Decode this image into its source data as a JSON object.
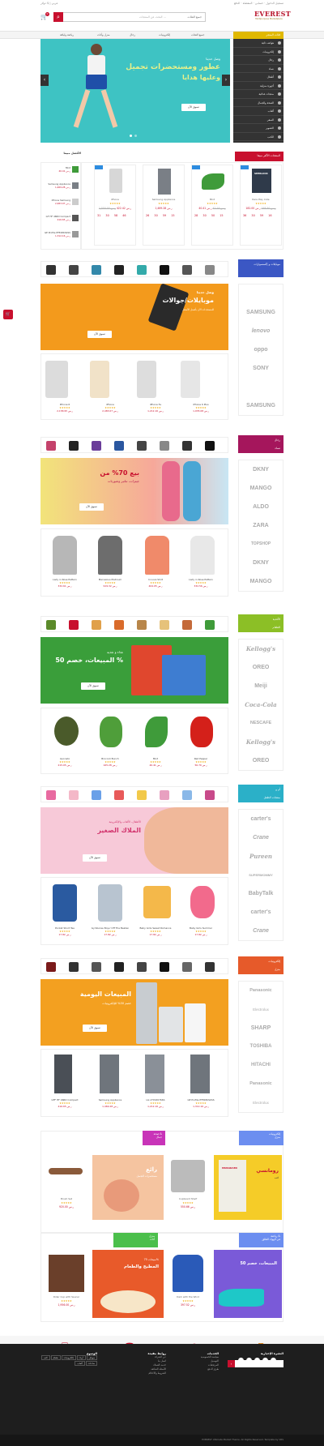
{
  "topbar": {
    "left": "عربي  |  $ دولار",
    "links": [
      "تسجيل الدخول",
      "حسابي",
      "المفضلة",
      "الدفع"
    ]
  },
  "header": {
    "logo": "EVEREST",
    "tagline": "Multipurpose Marketplace",
    "search_placeholder": "البحث عن المنتجات ...",
    "category_select": "جميع الفئات",
    "cart_count": "0"
  },
  "nav": {
    "categories_label": "فئات المتجر",
    "items": [
      "جميع الفئات",
      "إلكترونيات",
      "رجال",
      "منزل وأثاث",
      "رياضة ولياقة"
    ]
  },
  "sidebar": {
    "items": [
      "هواتف ذكية",
      "إلكترونيات",
      "رجال",
      "نساء",
      "أطفال",
      "أجهزة منزلية",
      "منتجات غذائية",
      "الصحة والجمال",
      "ألعاب",
      "السفر",
      "التصوير",
      "الكتب",
      "المزيد"
    ]
  },
  "slider": {
    "line1": "وصل حديثا",
    "line2": "عطور ومستحضرات تجميل",
    "line3": "وعليها هدايا",
    "button": "تسوق الآن"
  },
  "best_sellers": {
    "title": "المنتجات الأكثر مبيعا",
    "side_title": "الأفضل مبيعا",
    "products": [
      {
        "name": "Rare Play Cote",
        "old": "ر.س 193.50",
        "price": "ر.س 182.00",
        "timer": [
          "36",
          "30",
          "59",
          "16"
        ]
      },
      {
        "name": "Mint",
        "old": "ر.س 42.14",
        "price": "ر.س 40.41",
        "timer": [
          "28",
          "30",
          "50",
          "15"
        ]
      },
      {
        "name": "Samsung Appliance",
        "old": "",
        "price": "ر.س 1,469.28",
        "timer": [
          "26",
          "30",
          "59",
          "15"
        ]
      },
      {
        "name": "iPhone",
        "old": "ر.س 1,550.00",
        "price": "ر.س 422.42",
        "timer": [
          "31",
          "30",
          "58",
          "46"
        ]
      }
    ],
    "side": [
      {
        "name": "Mint",
        "price": "ر.س 40.41"
      },
      {
        "name": "Samsung Appliance",
        "price": "ر.س 1,469.28"
      },
      {
        "name": "iPhone Samsung",
        "price": "ر.س 2,483.07"
      },
      {
        "name": "GF HF 46RD Compact",
        "price": "ر.س 416.65"
      },
      {
        "name": "GE Profile PFE28KSKSS",
        "price": "ر.س 1,312.16"
      }
    ]
  },
  "phones": {
    "title": "موبايلات و إكسسوارات",
    "banner_l1": "وصل حديثا",
    "banner_l2": "موبايلات/جوالات",
    "banner_l3": "للمستجدات الآن بأفضل الأسعار",
    "button": "تسوق الآن",
    "brands": [
      "SAMSUNG",
      "lenovo",
      "oppo",
      "SONY",
      "SAMSUNG"
    ],
    "products": [
      {
        "name": "iPhone 6 Plus",
        "price": "ر.س 1,935.08"
      },
      {
        "name": "iPhone 5s",
        "price": "ر.س 1,212.16"
      },
      {
        "name": "iPhone",
        "price": "ر.س 2,483.07"
      },
      {
        "name": "iPhone 6",
        "price": "ر.س 2,158.95"
      }
    ]
  },
  "fashion": {
    "title": "رجال",
    "sub": "نساء",
    "banner_l1": "بيع 70% من",
    "banner_l2": "جينزات، تنانير وشورتات",
    "button": "تسوق الآن",
    "brands": [
      "DKNY",
      "MANGO",
      "ALDO",
      "ZARA",
      "TOPSHOP",
      "DKNY",
      "MANGO"
    ],
    "products": [
      {
        "name": "Lady in Rose Pattern",
        "price": "ر.س 332.56"
      },
      {
        "name": "In Love Shirt",
        "price": "ر.س 404.05"
      },
      {
        "name": "Marvelous Platinum",
        "price": "ر.س 919.32"
      },
      {
        "name": "Lady in Rose Pattern",
        "price": "ر.س 332.61"
      }
    ]
  },
  "food": {
    "title": "الأغذية",
    "sub": "الطعام",
    "banner_l1": "غذاء و تغذية",
    "banner_l2": "المبيعات، خصم 50 %",
    "button": "تسوق الآن",
    "brands": [
      "Kellogg's",
      "OREO",
      "Meiji",
      "Coca-Cola",
      "NESCAFE",
      "Kellogg's",
      "OREO"
    ],
    "products": [
      {
        "name": "Avocado",
        "price": "ر.س 215.05"
      },
      {
        "name": "Broccoli Bunch",
        "price": "ر.س 165.28"
      },
      {
        "name": "Mint",
        "price": "ر.س 40.41"
      },
      {
        "name": "Red Pepper",
        "price": "ر.س 56.70"
      }
    ]
  },
  "kids": {
    "title": "أم و",
    "sub": "منتجات الطفل",
    "banner_l1": "الأطفال، الألعاب والإلكترونية",
    "banner_l2": "الملاك الصغير",
    "button": "تسوق الآن",
    "brands": [
      "carter's",
      "Crane",
      "Pureen",
      "SUPERMOMMY",
      "BabyTalk",
      "carter's",
      "Crane"
    ],
    "products": [
      {
        "name": "Baby Girls Summer",
        "price": "ر.س 17.82"
      },
      {
        "name": "Baby Girls Sweet Romance",
        "price": "ر.س 17.82"
      },
      {
        "name": "Gymboree Boys' Off The Beaten",
        "price": "ر.س 17.82"
      },
      {
        "name": "Pocket Short Tee",
        "price": "ر.س 17.82"
      }
    ]
  },
  "electronics": {
    "title": "إلكترونيات",
    "sub": "منزل",
    "banner_l1": "المبيعات اليومية",
    "banner_l2": "خصم 30% للإلكترونيات",
    "button": "تسوق الآن",
    "brands": [
      "Panasonic",
      "Electrolux",
      "SHARP",
      "TOSHIBA",
      "HITACHI",
      "Panasonic",
      "Electrolux"
    ],
    "products": [
      {
        "name": "GE Profile PFE28KSKSS",
        "price": "ر.س 1,312.16"
      },
      {
        "name": "LG LFXS30766S",
        "price": "ر.س 1,212.16"
      },
      {
        "name": "Samsung Appliance",
        "price": "ر.س 1,469.28"
      },
      {
        "name": "GFF HF 46RD Compact",
        "price": "ر.س 416.65"
      }
    ]
  },
  "bottom": {
    "books": {
      "tag": "إلكترونيات",
      "sub": "منزل",
      "banner": "رومانسي",
      "sub2": "كتب",
      "book": "MURAKAMI",
      "name": "Cupboard Shelf",
      "price": "ر.س 550.66"
    },
    "beauty": {
      "tag": "صحة &",
      "sub": "جمال",
      "banner": "رائع",
      "sub2": "مستحضرات التجميل",
      "name": "Brush Set",
      "price": "ر.س 920.00"
    },
    "sports": {
      "tag": "رياضة &",
      "sub": "في الهواء الطلق",
      "banner": "المبيعات، خصم 50",
      "name": "Dark with the Wind",
      "price": "ر.س 397.52"
    },
    "kitchen": {
      "tag": "منزل",
      "sub": "أثاث",
      "banner": "المطبخ والطعام",
      "sub2": "مبيعات 75%",
      "name": "Rider Cup with Saucer",
      "price": "ر.س 1,956.00"
    }
  },
  "features": [
    {
      "title": "توصيل سريع",
      "text": "لجميع الطلبات"
    },
    {
      "title": "الشحن الدولي",
      "text": "أفضل الأسعار"
    },
    {
      "title": "الطلب عن طريق الهاتف",
      "text": "+20 123 456 789"
    },
    {
      "title": "بوابة دفع آمنة",
      "text": "دفع آمن 100%"
    }
  ],
  "footer": {
    "newsletter": "النشرة الإخبارية",
    "col1_title": "روابط مفيدة",
    "col1": [
      "عن الشركة",
      "اتصل بنا",
      "خدمة العملاء",
      "الأسئلة الشائعة",
      "الشروط والأحكام"
    ],
    "col2_title": "الخدمات",
    "col2": [
      "سياسة الخصوصية",
      "التوصيل",
      "المرتجعات",
      "طرق الدفع"
    ],
    "tags_title": "الوسوم",
    "tags": [
      "موبايل",
      "أزياء",
      "إلكترونيات",
      "طعام",
      "كتب",
      "ساعات",
      "ألعاب"
    ],
    "copyright": "EVEREST Ultimate Market Theme. All Rights Reserved. Template by VRS"
  }
}
